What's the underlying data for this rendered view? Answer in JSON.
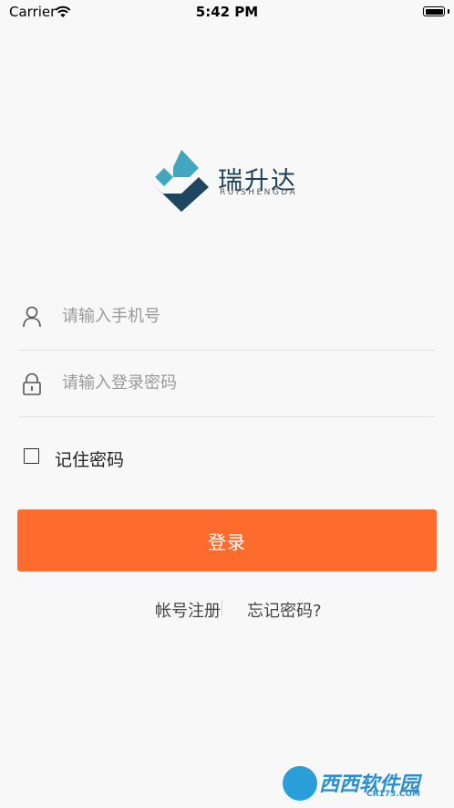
{
  "status_bar": {
    "carrier": "Carrier",
    "time": "5:42 PM"
  },
  "logo": {
    "name": "瑞升达",
    "subtitle": "RUISHENGDA",
    "colors": {
      "teal": "#41a6be",
      "navy": "#1e4660"
    }
  },
  "form": {
    "phone_placeholder": "请输入手机号",
    "password_placeholder": "请输入登录密码",
    "remember_label": "记住密码",
    "remember_checked": false,
    "login_label": "登录"
  },
  "links": {
    "register": "帐号注册",
    "forgot": "忘记密码?"
  },
  "watermark": {
    "text": "西西软件园",
    "site": "CR173.COM"
  },
  "colors": {
    "accent": "#fd6c2c",
    "background": "#f8f8f8"
  }
}
